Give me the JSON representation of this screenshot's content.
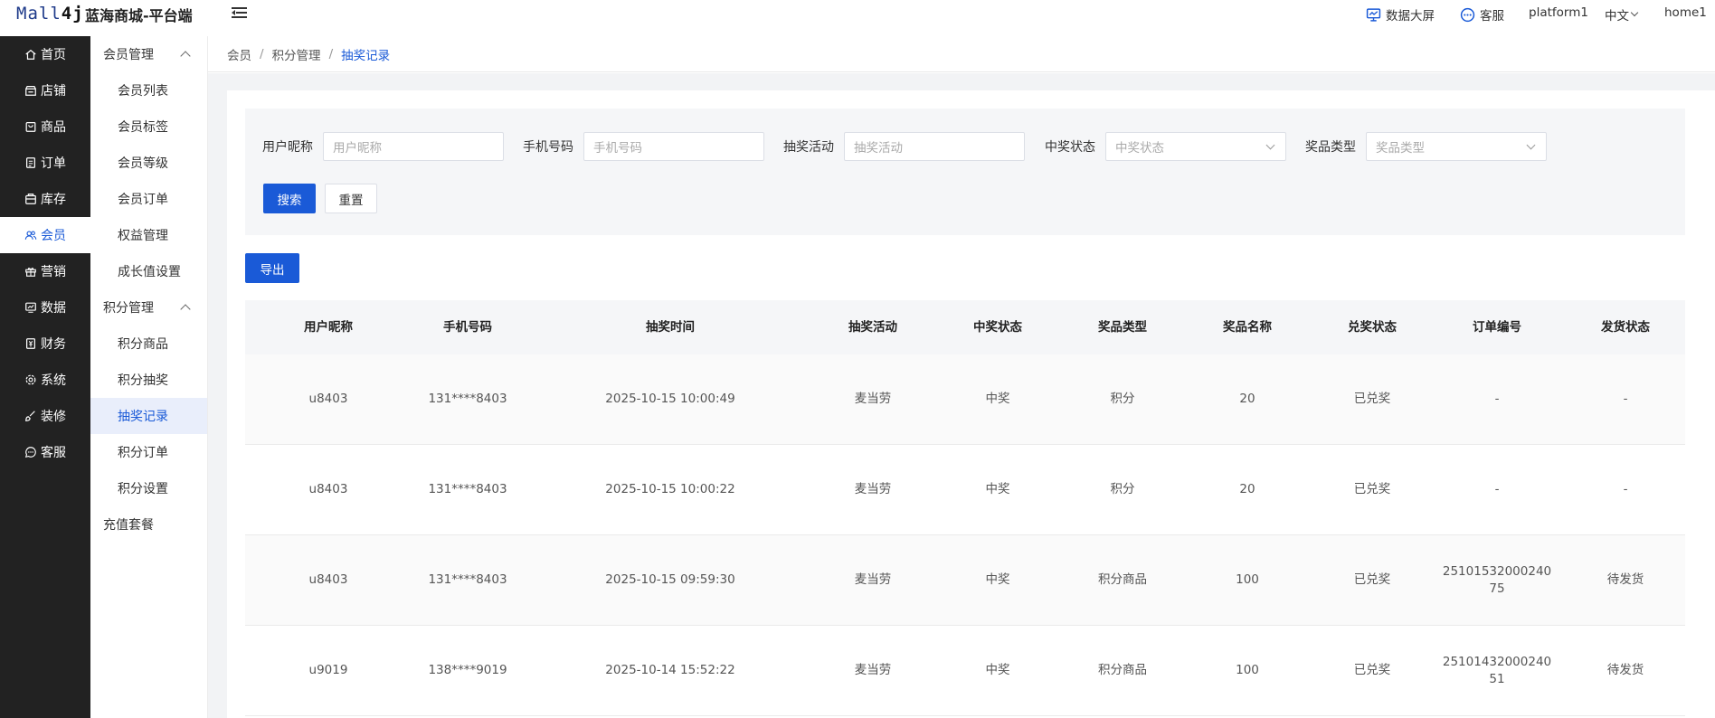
{
  "header": {
    "logo": {
      "prefix": "Mall",
      "suffix": "4j"
    },
    "site_title": "蓝海商城-平台端",
    "right": {
      "data_screen": "数据大屏",
      "service": "客服",
      "platform": "platform1",
      "language": "中文",
      "user": "home1"
    }
  },
  "sidebar_main": [
    {
      "label": "首页",
      "icon": "home-icon"
    },
    {
      "label": "店铺",
      "icon": "shop-icon"
    },
    {
      "label": "商品",
      "icon": "goods-icon"
    },
    {
      "label": "订单",
      "icon": "order-icon"
    },
    {
      "label": "库存",
      "icon": "stock-icon"
    },
    {
      "label": "会员",
      "icon": "member-icon",
      "active": true
    },
    {
      "label": "营销",
      "icon": "gift-icon"
    },
    {
      "label": "数据",
      "icon": "chart-icon"
    },
    {
      "label": "财务",
      "icon": "finance-icon"
    },
    {
      "label": "系统",
      "icon": "settings-icon"
    },
    {
      "label": "装修",
      "icon": "brush-icon"
    },
    {
      "label": "客服",
      "icon": "chat-icon"
    }
  ],
  "sidebar_sub": {
    "group1": "会员管理",
    "group1_items": [
      "会员列表",
      "会员标签",
      "会员等级",
      "会员订单",
      "权益管理",
      "成长值设置"
    ],
    "group2": "积分管理",
    "group2_items": [
      "积分商品",
      "积分抽奖",
      "抽奖记录",
      "积分订单",
      "积分设置"
    ],
    "extra": "充值套餐"
  },
  "breadcrumb": [
    "会员",
    "积分管理",
    "抽奖记录"
  ],
  "search": {
    "fields": [
      {
        "label": "用户昵称",
        "placeholder": "用户昵称"
      },
      {
        "label": "手机号码",
        "placeholder": "手机号码"
      },
      {
        "label": "抽奖活动",
        "placeholder": "抽奖活动"
      },
      {
        "label": "中奖状态",
        "placeholder": "中奖状态"
      },
      {
        "label": "奖品类型",
        "placeholder": "奖品类型"
      }
    ],
    "search_button": "搜索",
    "reset_button": "重置"
  },
  "export_button": "导出",
  "table": {
    "columns": [
      "用户昵称",
      "手机号码",
      "抽奖时间",
      "抽奖活动",
      "中奖状态",
      "奖品类型",
      "奖品名称",
      "兑奖状态",
      "订单编号",
      "发货状态"
    ],
    "rows": [
      [
        "u8403",
        "131****8403",
        "2025-10-15 10:00:49",
        "麦当劳",
        "中奖",
        "积分",
        "20",
        "已兑奖",
        "-",
        "-"
      ],
      [
        "u8403",
        "131****8403",
        "2025-10-15 10:00:22",
        "麦当劳",
        "中奖",
        "积分",
        "20",
        "已兑奖",
        "-",
        "-"
      ],
      [
        "u8403",
        "131****8403",
        "2025-10-15 09:59:30",
        "麦当劳",
        "中奖",
        "积分商品",
        "100",
        "已兑奖",
        "2510153200024075",
        "待发货"
      ],
      [
        "u9019",
        "138****9019",
        "2025-10-14 15:52:22",
        "麦当劳",
        "中奖",
        "积分商品",
        "100",
        "已兑奖",
        "2510143200024051",
        "待发货"
      ]
    ]
  },
  "colors": {
    "primary": "#1a5ad7",
    "sidebar": "#222222"
  }
}
